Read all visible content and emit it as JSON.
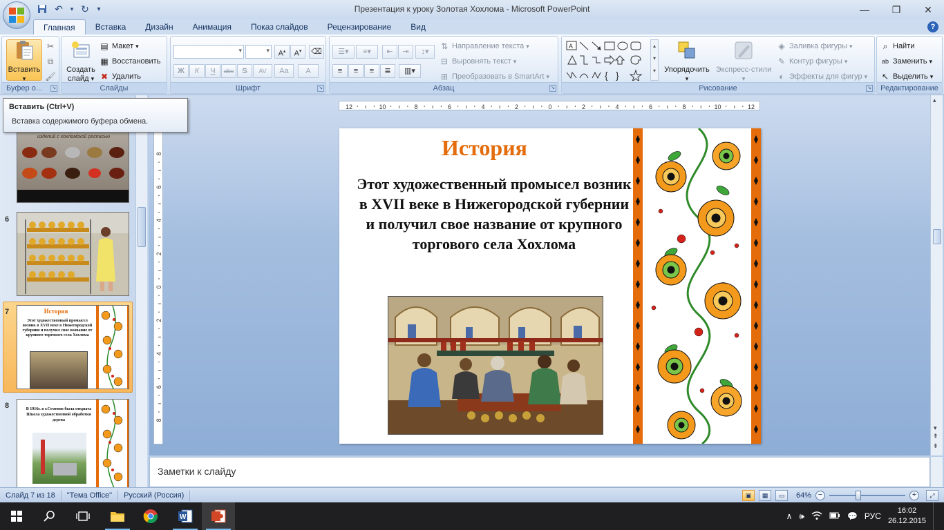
{
  "window": {
    "title": "Презентация к уроку Золотая Хохлома - Microsoft PowerPoint"
  },
  "tabs": [
    {
      "label": "Главная",
      "active": true
    },
    {
      "label": "Вставка"
    },
    {
      "label": "Дизайн"
    },
    {
      "label": "Анимация"
    },
    {
      "label": "Показ слайдов"
    },
    {
      "label": "Рецензирование"
    },
    {
      "label": "Вид"
    }
  ],
  "ribbon": {
    "clipboard": {
      "label": "Буфер о...",
      "paste": "Вставить"
    },
    "slides": {
      "label": "Слайды",
      "create": "Создать",
      "create2": "слайд",
      "layout": "Макет",
      "restore": "Восстановить",
      "delete": "Удалить"
    },
    "font": {
      "label": "Шрифт",
      "bold": "Ж",
      "italic": "К",
      "underline": "Ч",
      "strike": "abc",
      "shadow": "S",
      "spacing": "AV",
      "case": "Aa",
      "color": "A"
    },
    "paragraph": {
      "label": "Абзац",
      "text_direction": "Направление текста",
      "align_text": "Выровнять текст",
      "smartart": "Преобразовать в SmartArt"
    },
    "drawing": {
      "label": "Рисование",
      "arrange": "Упорядочить",
      "quick_styles": "Экспресс-стили",
      "fill": "Заливка фигуры",
      "outline": "Контур фигуры",
      "effects": "Эффекты для фигур"
    },
    "editing": {
      "label": "Редактирование",
      "find": "Найти",
      "replace": "Заменить",
      "select": "Выделить"
    }
  },
  "tooltip": {
    "title": "Вставить (Ctrl+V)",
    "description": "Вставка содержимого буфера обмена."
  },
  "ruler": {
    "h_labels": [
      "12",
      "10",
      "8",
      "6",
      "4",
      "2",
      "0",
      "2",
      "4",
      "6",
      "8",
      "10",
      "12"
    ],
    "v_labels": [
      "8",
      "6",
      "4",
      "2",
      "0",
      "2",
      "4",
      "6",
      "8"
    ]
  },
  "thumbnails": [
    {
      "number": "",
      "kind": "bowls",
      "caption": "Технологический процесс изготовления изделий с хохломской росписью"
    },
    {
      "number": "6",
      "kind": "workshop"
    },
    {
      "number": "7",
      "kind": "history",
      "title": "История",
      "text": "Этот художественный промысел возник в XVII веке в Нижегородской губернии и получил свое название от крупного торгового села Хохлома",
      "selected": true
    },
    {
      "number": "8",
      "kind": "school",
      "text": "В 1916г. в г.Семенов была открыта Школа художественной обработки дерева"
    }
  ],
  "slide": {
    "title": "История",
    "body": "Этот художественный промысел возник в XVII веке в Нижегородской губернии и получил свое название от крупного торгового села Хохлома"
  },
  "notes": {
    "placeholder": "Заметки к слайду"
  },
  "status": {
    "slide": "Слайд 7 из 18",
    "theme": "\"Тема Office\"",
    "language": "Русский (Россия)",
    "zoom": "64%"
  },
  "taskbar": {
    "language": "РУС",
    "time": "16:02",
    "date": "26.12.2015"
  },
  "colors": {
    "title_orange": "#e46c0a",
    "ribbon_blue": "#cddcef"
  }
}
